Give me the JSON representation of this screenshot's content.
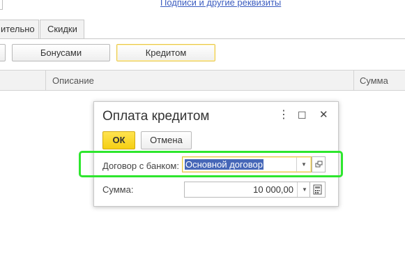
{
  "top_link": "Подписи и другие реквизиты",
  "tabs": [
    {
      "label": "ительно"
    },
    {
      "label": "Скидки"
    }
  ],
  "payment_buttons": [
    {
      "label": ""
    },
    {
      "label": "Бонусами"
    },
    {
      "label": "Кредитом"
    }
  ],
  "grid": {
    "columns": [
      "Описание",
      "Сумма"
    ]
  },
  "dialog": {
    "title": "Оплата кредитом",
    "more_icon": "⋮",
    "maximize_icon": "☐",
    "close_icon": "✕",
    "ok_label": "ОК",
    "cancel_label": "Отмена",
    "contract_label": "Договор с банком:",
    "contract_value": "Основной договор",
    "sum_label": "Сумма:",
    "sum_value": "10 000,00"
  },
  "colors": {
    "accent_yellow": "#f5cf13",
    "highlight_green": "#2ee62e",
    "link_blue": "#3a5bbf",
    "selection_blue": "#4667b8"
  }
}
